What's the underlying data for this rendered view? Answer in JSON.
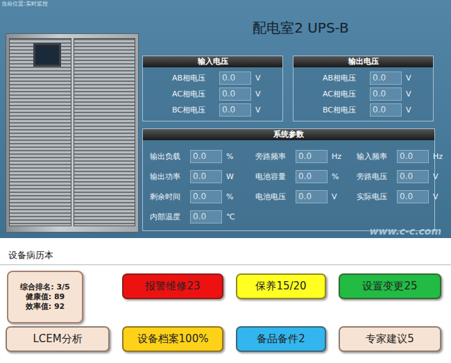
{
  "breadcrumb": "当前位置:实时监控",
  "title": "配电室2 UPS-B",
  "voltage_panels": [
    {
      "title": "输入电压",
      "rows": [
        {
          "label": "AB相电压",
          "value": "0.0",
          "unit": "V"
        },
        {
          "label": "AC相电压",
          "value": "0.0",
          "unit": "V"
        },
        {
          "label": "BC相电压",
          "value": "0.0",
          "unit": "V"
        }
      ]
    },
    {
      "title": "输出电压",
      "rows": [
        {
          "label": "AB相电压",
          "value": "0.0",
          "unit": "V"
        },
        {
          "label": "AC相电压",
          "value": "0.0",
          "unit": "V"
        },
        {
          "label": "BC相电压",
          "value": "0.0",
          "unit": "V"
        }
      ]
    }
  ],
  "system_panel": {
    "title": "系统参数",
    "items": [
      {
        "label": "输出负载",
        "value": "0.0",
        "unit": "%"
      },
      {
        "label": "旁路频率",
        "value": "0.0",
        "unit": "Hz"
      },
      {
        "label": "输入频率",
        "value": "0.0",
        "unit": "Hz"
      },
      {
        "label": "输出功率",
        "value": "0.0",
        "unit": "W"
      },
      {
        "label": "电池容量",
        "value": "0.0",
        "unit": "%"
      },
      {
        "label": "旁路电压",
        "value": "0.0",
        "unit": "V"
      },
      {
        "label": "剩余时间",
        "value": "0.0",
        "unit": "%"
      },
      {
        "label": "电池电压",
        "value": "0.0",
        "unit": "V"
      },
      {
        "label": "实际电压",
        "value": "0.0",
        "unit": "V"
      },
      {
        "label": "内部温度",
        "value": "0.0",
        "unit": "℃"
      }
    ]
  },
  "watermark": "www.c-c.com",
  "record": {
    "title": "设备病历本",
    "summary": [
      "综合排名: 3/5",
      "健康值: 89",
      "效率值: 92"
    ],
    "buttons": [
      {
        "label": "报警维修23",
        "color": "#ee1111"
      },
      {
        "label": "保养15/20",
        "color": "#ffff22"
      },
      {
        "label": "设置变更25",
        "color": "#22bb44"
      },
      {
        "label": "LCEM分析",
        "color": "#f7e3d3"
      },
      {
        "label": "设备档案100%",
        "color": "#ffd21a"
      },
      {
        "label": "备品备件2",
        "color": "#33b5ee"
      },
      {
        "label": "专家建议5",
        "color": "#f7e3d3"
      }
    ]
  }
}
